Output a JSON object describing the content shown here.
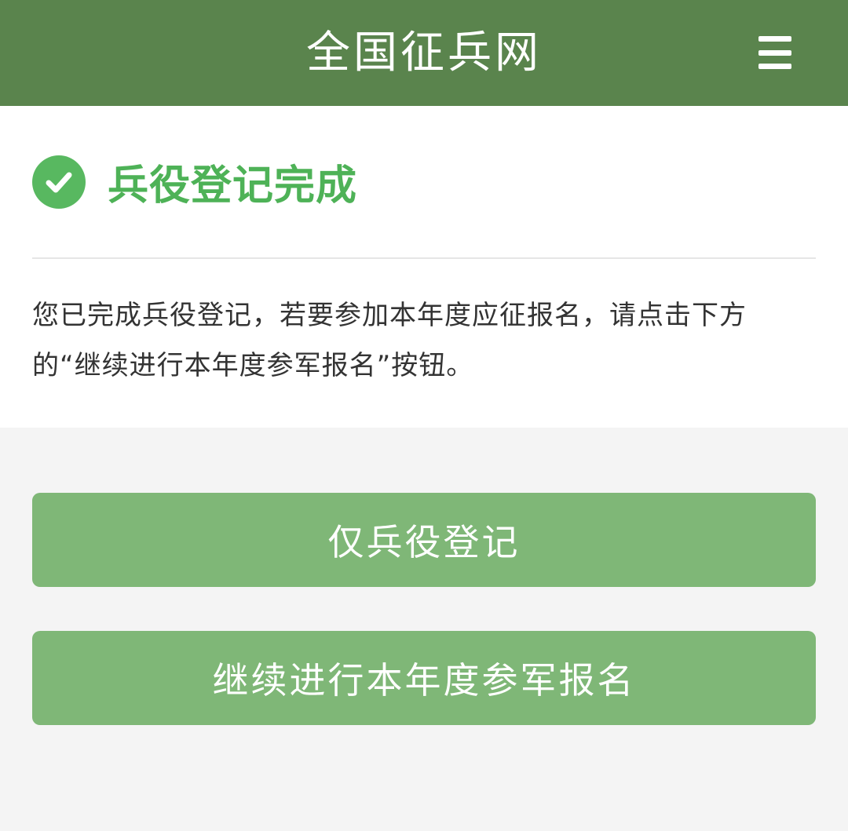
{
  "header": {
    "title": "全国征兵网",
    "menu_icon": "hamburger-menu-icon"
  },
  "status": {
    "icon": "check-circle-icon",
    "title": "兵役登记完成",
    "message": "您已完成兵役登记，若要参加本年度应征报名，请点击下方的“继续进行本年度参军报名”按钮。"
  },
  "actions": {
    "registration_only_label": "仅兵役登记",
    "continue_enlistment_label": "继续进行本年度参军报名"
  },
  "colors": {
    "header_bg": "#5a844d",
    "success_green": "#4eb257",
    "button_bg": "#7fb777",
    "page_bg": "#f4f4f4"
  }
}
